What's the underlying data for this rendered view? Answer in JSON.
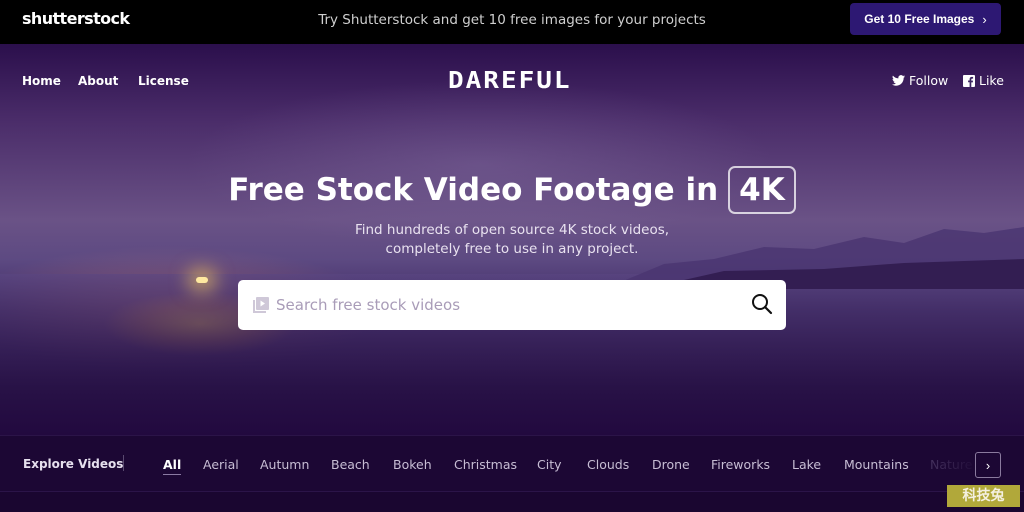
{
  "promo": {
    "logo": "shutterstock",
    "text": "Try Shutterstock and get 10 free images for your projects",
    "cta_label": "Get 10 Free Images",
    "cta_icon": "chevron-right-icon",
    "cta_color": "#2d1873"
  },
  "nav": {
    "links": [
      "Home",
      "About",
      "License"
    ],
    "brand": "DAREFUL",
    "social": [
      {
        "icon": "twitter-icon",
        "label": "Follow"
      },
      {
        "icon": "facebook-icon",
        "label": "Like"
      }
    ]
  },
  "hero": {
    "headline": "Free Stock Video Footage in",
    "badge": "4K",
    "subtitle_line1": "Find hundreds of open source 4K stock videos,",
    "subtitle_line2": "completely free to use in any project.",
    "search_placeholder": "Search free stock videos",
    "search_value": ""
  },
  "explore": {
    "label": "Explore Videos",
    "categories": [
      "All",
      "Aerial",
      "Autumn",
      "Beach",
      "Bokeh",
      "Christmas",
      "City",
      "Clouds",
      "Drone",
      "Fireworks",
      "Lake",
      "Mountains",
      "Nature"
    ],
    "active": "All",
    "next_icon": "chevron-right-icon"
  },
  "watermark": "科技兔"
}
